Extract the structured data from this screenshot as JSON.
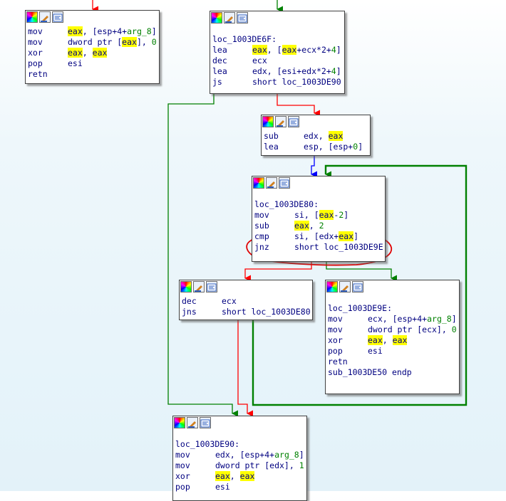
{
  "graph": {
    "edge_colors": {
      "true": "#ff0000",
      "false": "#008000",
      "unconditional": "#0000ff",
      "highlight": "#e00000"
    },
    "icons": [
      "color-picker-icon",
      "rename-icon",
      "group-nodes-icon"
    ]
  },
  "nodes": [
    {
      "id": "block-top-left",
      "label": null,
      "lines": [
        {
          "mnemonic": "mov",
          "ops": [
            {
              "t": "eax",
              "hl": true
            },
            {
              "t": ", [esp+4+"
            },
            {
              "t": "arg_8",
              "c": "sym"
            },
            {
              "t": "]"
            }
          ]
        },
        {
          "mnemonic": "mov",
          "ops": [
            {
              "t": "dword ptr ["
            },
            {
              "t": "eax",
              "hl": true
            },
            {
              "t": "], "
            },
            {
              "t": "0",
              "c": "num"
            }
          ]
        },
        {
          "mnemonic": "xor",
          "ops": [
            {
              "t": "eax",
              "hl": true
            },
            {
              "t": ", "
            },
            {
              "t": "eax",
              "hl": true
            }
          ]
        },
        {
          "mnemonic": "pop",
          "ops": [
            {
              "t": "esi"
            }
          ]
        },
        {
          "mnemonic": "retn",
          "ops": []
        }
      ]
    },
    {
      "id": "block-loc_1003DE6F",
      "label": "loc_1003DE6F:",
      "lines": [
        {
          "mnemonic": "lea",
          "ops": [
            {
              "t": "eax",
              "hl": true
            },
            {
              "t": ", ["
            },
            {
              "t": "eax",
              "hl": true
            },
            {
              "t": "+ecx*2+"
            },
            {
              "t": "4",
              "c": "num"
            },
            {
              "t": "]"
            }
          ]
        },
        {
          "mnemonic": "dec",
          "ops": [
            {
              "t": "ecx"
            }
          ]
        },
        {
          "mnemonic": "lea",
          "ops": [
            {
              "t": "edx, [esi+edx*2+"
            },
            {
              "t": "4",
              "c": "num"
            },
            {
              "t": "]"
            }
          ]
        },
        {
          "mnemonic": "js",
          "ops": [
            {
              "t": "short loc_1003DE90"
            }
          ]
        }
      ]
    },
    {
      "id": "block-sub-lea",
      "label": null,
      "lines": [
        {
          "mnemonic": "sub",
          "ops": [
            {
              "t": "edx, "
            },
            {
              "t": "eax",
              "hl": true
            }
          ]
        },
        {
          "mnemonic": "lea",
          "ops": [
            {
              "t": "esp, [esp+"
            },
            {
              "t": "0",
              "c": "num"
            },
            {
              "t": "]"
            }
          ]
        }
      ]
    },
    {
      "id": "block-loc_1003DE80",
      "label": "loc_1003DE80:",
      "lines": [
        {
          "mnemonic": "mov",
          "ops": [
            {
              "t": "si, ["
            },
            {
              "t": "eax",
              "hl": true
            },
            {
              "t": "-"
            },
            {
              "t": "2",
              "c": "num"
            },
            {
              "t": "]"
            }
          ]
        },
        {
          "mnemonic": "sub",
          "ops": [
            {
              "t": "eax",
              "hl": true
            },
            {
              "t": ", "
            },
            {
              "t": "2",
              "c": "num"
            }
          ]
        },
        {
          "mnemonic": "cmp",
          "ops": [
            {
              "t": "si, [edx+"
            },
            {
              "t": "eax",
              "hl": true
            },
            {
              "t": "]"
            }
          ]
        },
        {
          "mnemonic": "jnz",
          "ops": [
            {
              "t": "short loc_1003DE9E"
            }
          ]
        }
      ]
    },
    {
      "id": "block-dec-jns",
      "label": null,
      "lines": [
        {
          "mnemonic": "dec",
          "ops": [
            {
              "t": "ecx"
            }
          ]
        },
        {
          "mnemonic": "jns",
          "ops": [
            {
              "t": "short loc_1003DE80"
            }
          ]
        }
      ]
    },
    {
      "id": "block-loc_1003DE9E",
      "label": "loc_1003DE9E:",
      "lines": [
        {
          "mnemonic": "mov",
          "ops": [
            {
              "t": "ecx, [esp+4+"
            },
            {
              "t": "arg_8",
              "c": "sym"
            },
            {
              "t": "]"
            }
          ]
        },
        {
          "mnemonic": "mov",
          "ops": [
            {
              "t": "dword ptr [ecx], "
            },
            {
              "t": "0",
              "c": "num"
            }
          ]
        },
        {
          "mnemonic": "xor",
          "ops": [
            {
              "t": "eax",
              "hl": true
            },
            {
              "t": ", "
            },
            {
              "t": "eax",
              "hl": true
            }
          ]
        },
        {
          "mnemonic": "pop",
          "ops": [
            {
              "t": "esi"
            }
          ]
        },
        {
          "mnemonic": "retn",
          "ops": []
        },
        {
          "mnemonic": "sub_1003DE50 endp",
          "ops": [],
          "raw": true
        }
      ]
    },
    {
      "id": "block-loc_1003DE90",
      "label": "loc_1003DE90:",
      "lines": [
        {
          "mnemonic": "mov",
          "ops": [
            {
              "t": "edx, [esp+4+"
            },
            {
              "t": "arg_8",
              "c": "sym"
            },
            {
              "t": "]"
            }
          ]
        },
        {
          "mnemonic": "mov",
          "ops": [
            {
              "t": "dword ptr [edx], "
            },
            {
              "t": "1",
              "c": "num"
            }
          ]
        },
        {
          "mnemonic": "xor",
          "ops": [
            {
              "t": "eax",
              "hl": true
            },
            {
              "t": ", "
            },
            {
              "t": "eax",
              "hl": true
            }
          ]
        },
        {
          "mnemonic": "pop",
          "ops": [
            {
              "t": "esi"
            }
          ]
        }
      ]
    }
  ]
}
